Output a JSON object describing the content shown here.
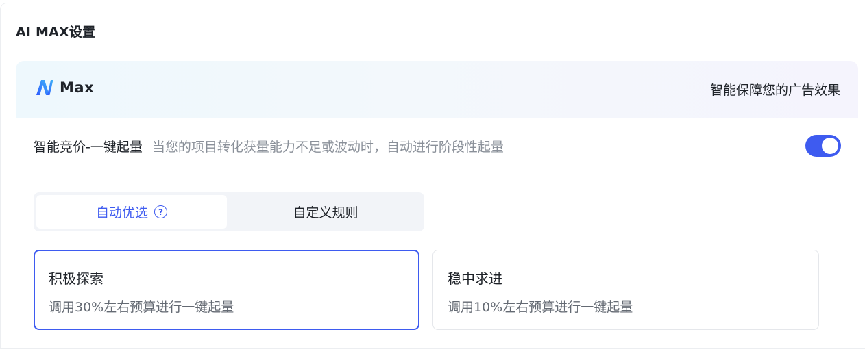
{
  "section": {
    "title": "AI MAX设置"
  },
  "banner": {
    "logo_text": "Max",
    "slogan": "智能保障您的广告效果",
    "gradient_start": "#eef8fd",
    "gradient_end": "#f5f4fd"
  },
  "feature": {
    "title": "智能竞价-一键起量",
    "description": "当您的项目转化获量能力不足或波动时，自动进行阶段性起量",
    "enabled": true,
    "toggle_color": "#3e5bf0"
  },
  "mode_tabs": [
    {
      "label": "自动优选",
      "active": true,
      "icon": "question-circle-icon"
    },
    {
      "label": "自定义规则",
      "active": false
    }
  ],
  "options": [
    {
      "title": "积极探索",
      "description": "调用30%左右预算进行一键起量",
      "selected": true
    },
    {
      "title": "稳中求进",
      "description": "调用10%左右预算进行一键起量",
      "selected": false
    }
  ],
  "colors": {
    "accent": "#3e5bf0",
    "text_primary": "#1f2329",
    "text_secondary": "#8a9099",
    "text_desc": "#646a73",
    "tab_bg": "#f2f4f8",
    "border": "#e5e7eb",
    "logo_gradient": [
      "#2f5bff",
      "#3fb6f7"
    ]
  }
}
